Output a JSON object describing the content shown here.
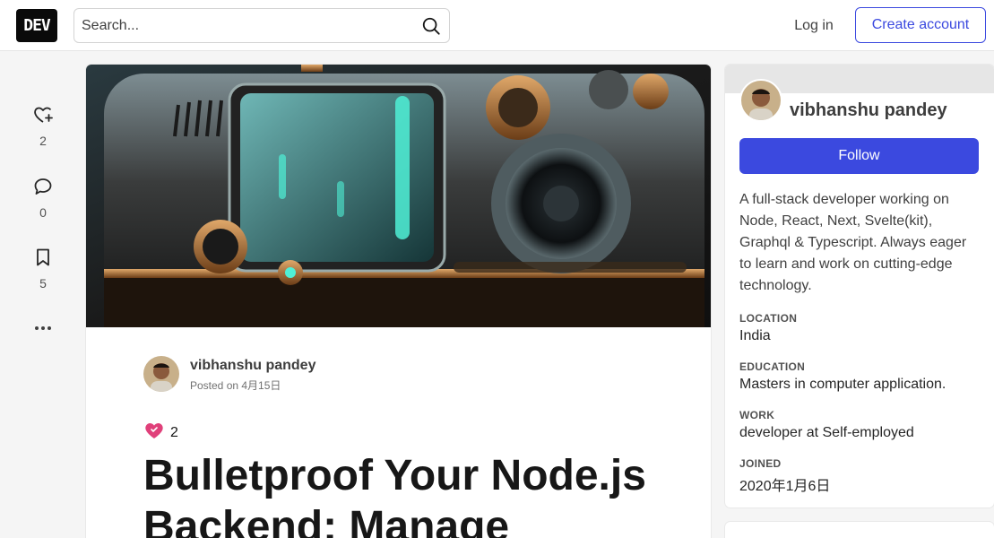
{
  "header": {
    "logo_text": "DEV",
    "search_placeholder": "Search...",
    "login_label": "Log in",
    "create_account_label": "Create account"
  },
  "actions": {
    "reactions_count": "2",
    "comments_count": "0",
    "bookmarks_count": "5",
    "more_icon": "more-horizontal-icon"
  },
  "article": {
    "author_name": "vibhanshu pandey",
    "posted": "Posted on 4月15日",
    "reaction_count": "2",
    "title": "Bulletproof Your Node.js Backend: Manage"
  },
  "profile": {
    "name": "vibhanshu pandey",
    "follow_label": "Follow",
    "bio": "A full-stack developer working on Node, React, Next, Svelte(kit), Graphql & Typescript. Always eager to learn and work on cutting-edge technology.",
    "fields": [
      {
        "key": "LOCATION",
        "value": "India"
      },
      {
        "key": "EDUCATION",
        "value": "Masters in computer application."
      },
      {
        "key": "WORK",
        "value": "developer at Self-employed"
      },
      {
        "key": "JOINED",
        "value": "2020年1月6日"
      }
    ]
  },
  "colors": {
    "accent": "#3b49df",
    "page_bg": "#f5f5f5"
  }
}
